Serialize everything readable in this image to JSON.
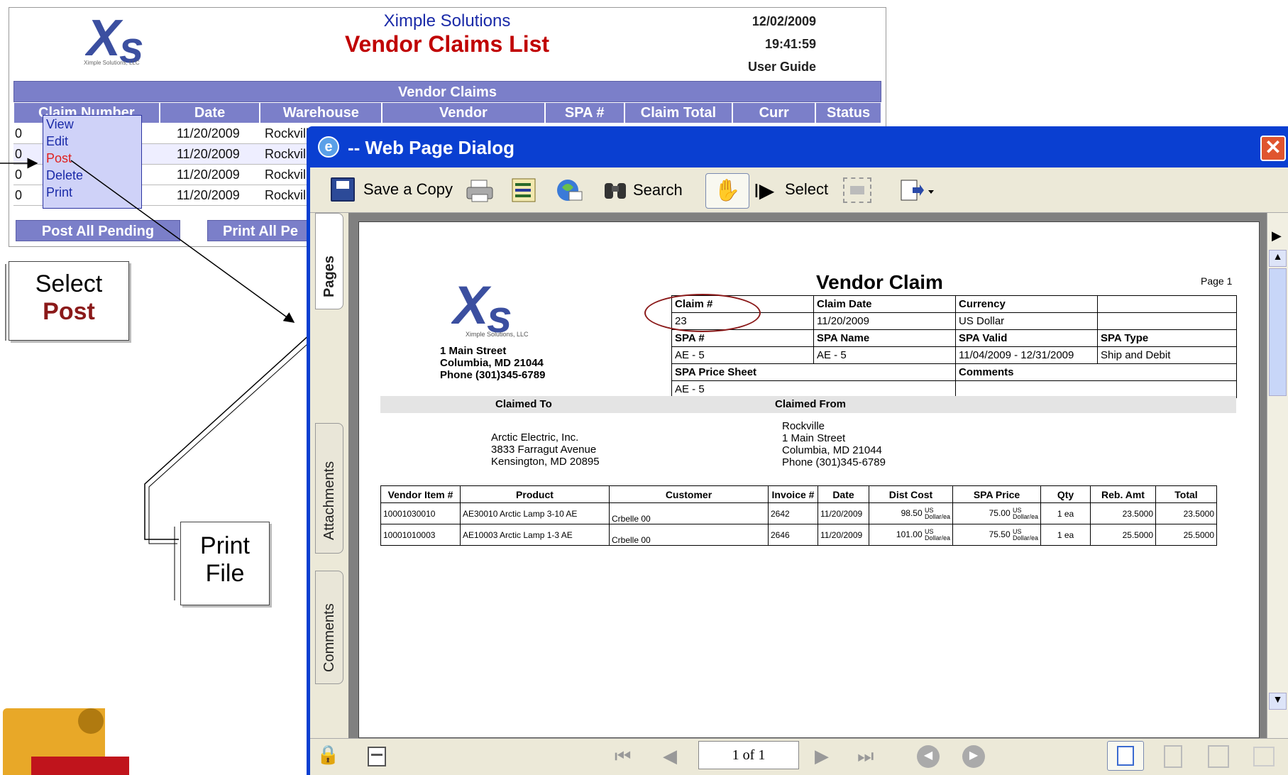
{
  "app": {
    "company": "Ximple Solutions",
    "title": "Vendor Claims List",
    "date": "12/02/2009",
    "time": "19:41:59",
    "guide_link": "User Guide",
    "logo_sub": "Ximple Solutions, LLC",
    "table_title": "Vendor Claims",
    "columns": [
      "Claim Number",
      "Date",
      "Warehouse",
      "Vendor",
      "SPA #",
      "Claim Total",
      "Curr",
      "Status"
    ],
    "rows": [
      {
        "claim": "0",
        "date": "11/20/2009",
        "warehouse": "Rockvill"
      },
      {
        "claim": "0",
        "date": "11/20/2009",
        "warehouse": "Rockvill"
      },
      {
        "claim": "0",
        "date": "11/20/2009",
        "warehouse": "Rockvill"
      },
      {
        "claim": "0",
        "date": "11/20/2009",
        "warehouse": "Rockvill"
      }
    ],
    "context_menu": [
      "View",
      "Edit",
      "Post",
      "Delete",
      "Print"
    ],
    "post_all_button": "Post All Pending",
    "print_all_button": "Print All Pe"
  },
  "callouts": {
    "select_line1": "Select",
    "select_line2": "Post",
    "print_line1": "Print",
    "print_line2": "File"
  },
  "dialog": {
    "title": "-- Web Page Dialog",
    "toolbar": {
      "save_copy": "Save a Copy",
      "search": "Search",
      "select": "Select"
    },
    "tabs": [
      "Pages",
      "Attachments",
      "Comments"
    ],
    "page_indicator": "1 of 1"
  },
  "document": {
    "heading": "Vendor Claim",
    "page_label": "Page 1",
    "logo_sub": "Ximple Solutions, LLC",
    "address": [
      "1 Main Street",
      "Columbia, MD  21044",
      "Phone (301)345-6789"
    ],
    "info": {
      "claim_no_label": "Claim #",
      "claim_no": "23",
      "claim_date_label": "Claim Date",
      "claim_date": "11/20/2009",
      "currency_label": "Currency",
      "currency": "US Dollar",
      "spa_no_label": "SPA #",
      "spa_no": "AE - 5",
      "spa_name_label": "SPA Name",
      "spa_name": "AE - 5",
      "spa_valid_label": "SPA Valid",
      "spa_valid": "11/04/2009 - 12/31/2009",
      "spa_type_label": "SPA Type",
      "spa_type": "Ship and Debit",
      "price_sheet_label": "SPA Price Sheet",
      "price_sheet": "AE - 5",
      "comments_label": "Comments"
    },
    "claimed_to_label": "Claimed To",
    "claimed_from_label": "Claimed From",
    "claimed_to": [
      "Arctic Electric, Inc.",
      "3833 Farragut Avenue",
      "Kensington, MD  20895"
    ],
    "claimed_from": [
      "Rockville",
      "1 Main Street",
      "Columbia, MD  21044",
      "Phone (301)345-6789"
    ],
    "item_columns": [
      "Vendor Item #",
      "Product",
      "Customer",
      "Invoice #",
      "Date",
      "Dist Cost",
      "SPA Price",
      "Qty",
      "Reb. Amt",
      "Total"
    ],
    "items": [
      {
        "vendor_item": "10001030010",
        "product": "AE30010 Arctic Lamp 3-10 AE",
        "customer": "Crbelle 00",
        "invoice": "2642",
        "date": "11/20/2009",
        "dist_cost": "98.50",
        "dist_unit_a": "US",
        "dist_unit_b": "Dollar/ea",
        "spa_price": "75.00",
        "spa_unit_a": "US",
        "spa_unit_b": "Dollar/ea",
        "qty": "1 ea",
        "reb_amt": "23.5000",
        "total": "23.5000"
      },
      {
        "vendor_item": "10001010003",
        "product": "AE10003 Arctic Lamp 1-3 AE",
        "customer": "Crbelle 00",
        "invoice": "2646",
        "date": "11/20/2009",
        "dist_cost": "101.00",
        "dist_unit_a": "US",
        "dist_unit_b": "Dollar/ea",
        "spa_price": "75.50",
        "spa_unit_a": "US",
        "spa_unit_b": "Dollar/ea",
        "qty": "1 ea",
        "reb_amt": "25.5000",
        "total": "25.5000"
      }
    ]
  },
  "colors": {
    "header_band": "#7b7fc9",
    "title_red": "#c00000",
    "dialog_blue": "#0a3fd1",
    "close_red": "#e0552f"
  }
}
